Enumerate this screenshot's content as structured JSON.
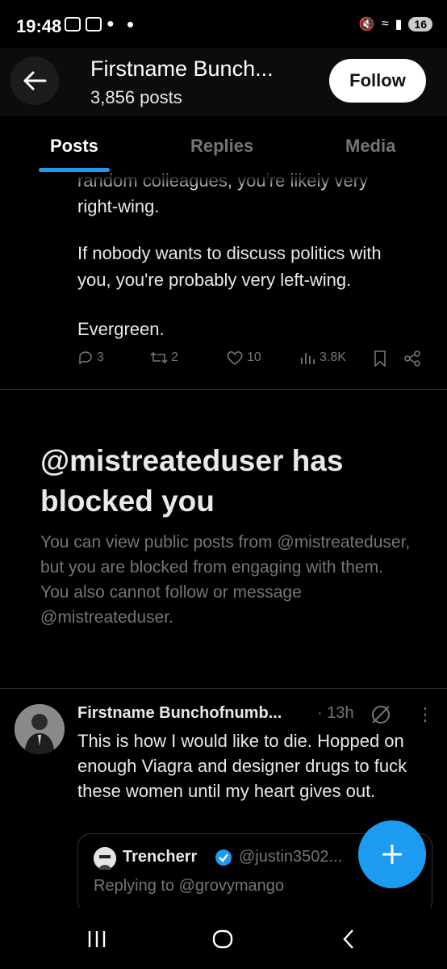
{
  "status_bar": {
    "time": "19:48",
    "battery": "16"
  },
  "header": {
    "title": "Firstname Bunch...",
    "subtitle": "3,856 posts",
    "follow_label": "Follow"
  },
  "tabs": [
    {
      "label": "Posts"
    },
    {
      "label": "Replies"
    },
    {
      "label": "Media"
    }
  ],
  "post": {
    "lines": [
      "random colleagues, you're likely very",
      "right-wing.",
      "If nobody wants to discuss politics with",
      "you, you're probably very left-wing.",
      "Evergreen."
    ],
    "replies": "3",
    "reposts": "2",
    "likes": "10",
    "views": "3.8K"
  },
  "blocked": {
    "title": "@mistreateduser has blocked you",
    "description": "You can view public posts from @mistreateduser, but you are blocked from engaging with them. You also cannot follow or message @mistreateduser."
  },
  "tweet": {
    "name": "Firstname Bunchofnumb...",
    "time": "· 13h",
    "body": "This is how I would like to die. Hopped on enough Viagra and designer drugs to fuck these women until my heart gives out.",
    "quote": {
      "name": "Trencherr",
      "handle": "@justin3502...",
      "replying": "Replying to @grovymango"
    }
  },
  "colors": {
    "accent": "#1d9bf0",
    "muted": "#71767b",
    "background": "#000000"
  }
}
